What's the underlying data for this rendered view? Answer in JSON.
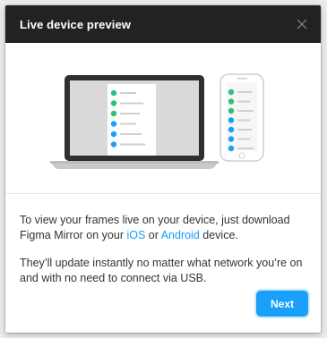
{
  "dialog": {
    "title": "Live device preview",
    "close_icon": "close-icon"
  },
  "body": {
    "p1_text_before": "To view your frames live on your device, just download Figma Mirror on your ",
    "link_ios": "iOS",
    "p1_or": " or ",
    "link_android": "Android",
    "p1_text_after": " device.",
    "p2": "They’ll update instantly no matter what network you’re on and with no need to connect via USB."
  },
  "footer": {
    "next_label": "Next"
  },
  "colors": {
    "header": "#222222",
    "accent": "#18a0fb",
    "green_dot": "#30c07a",
    "blue_dot": "#18a0fb"
  },
  "illustration": {
    "laptop_list_dots": [
      "green",
      "green",
      "green",
      "blue",
      "blue",
      "blue"
    ],
    "phone_list_dots": [
      "green",
      "green",
      "green",
      "blue",
      "blue",
      "blue",
      "blue"
    ]
  }
}
